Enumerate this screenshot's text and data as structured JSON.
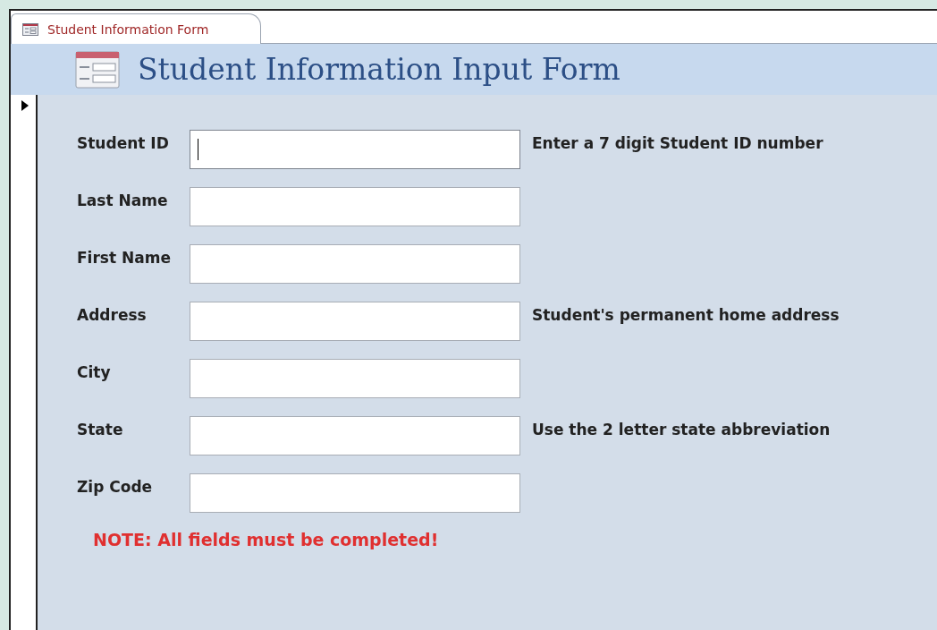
{
  "tab": {
    "label": "Student Information Form",
    "selected": true
  },
  "header": {
    "title": "Student Information Input Form"
  },
  "fields": [
    {
      "label": "Student ID",
      "focused": true,
      "hint": "Enter a 7 digit Student ID number"
    },
    {
      "label": "Last Name",
      "focused": false
    },
    {
      "label": "First Name",
      "focused": false
    },
    {
      "label": "Address",
      "focused": false,
      "hint": "Student's permanent home address"
    },
    {
      "label": "City",
      "focused": false
    },
    {
      "label": "State",
      "focused": false,
      "hint": "Use the 2 letter state abbreviation"
    },
    {
      "label": "Zip Code",
      "focused": false
    }
  ],
  "note": "NOTE: All fields must be completed!"
}
